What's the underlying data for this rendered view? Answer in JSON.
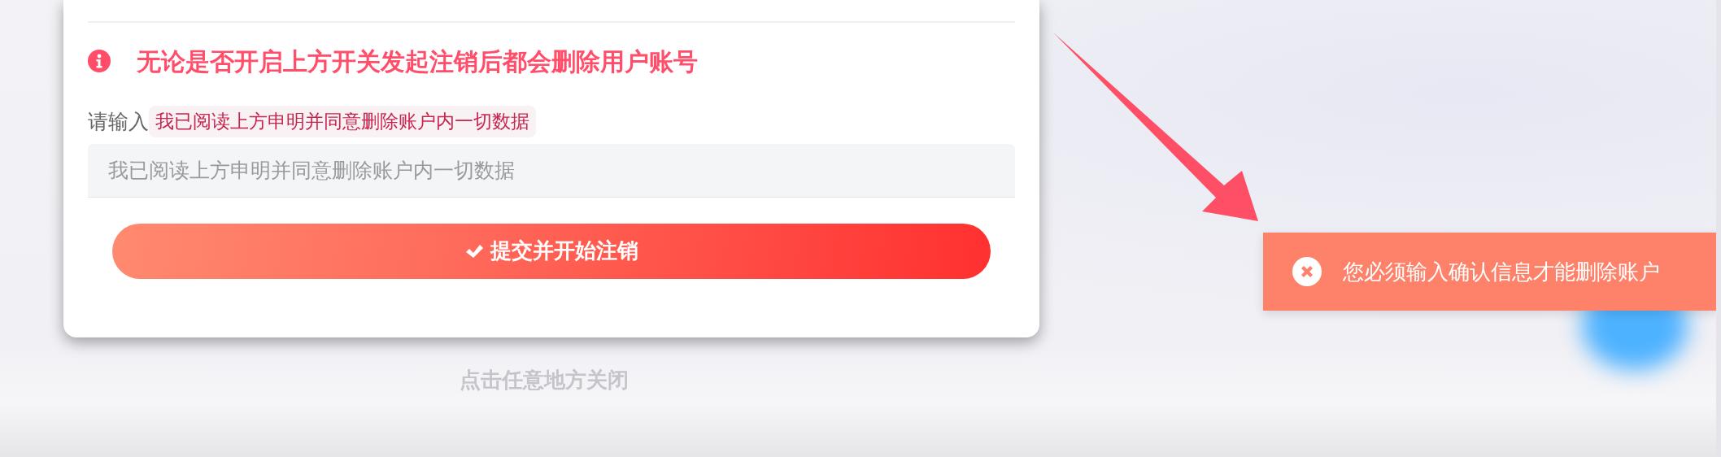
{
  "dialog": {
    "warning": {
      "text": "无论是否开启上方开关发起注销后都会删除用户账号"
    },
    "prompt": {
      "label": "请输入",
      "phrase": "我已阅读上方申明并同意删除账户内一切数据"
    },
    "input": {
      "placeholder": "我已阅读上方申明并同意删除账户内一切数据"
    },
    "submit_button": {
      "label": "提交并开始注销"
    }
  },
  "close_hint": "点击任意地方关闭",
  "toast": {
    "message": "您必须输入确认信息才能删除账户"
  }
}
